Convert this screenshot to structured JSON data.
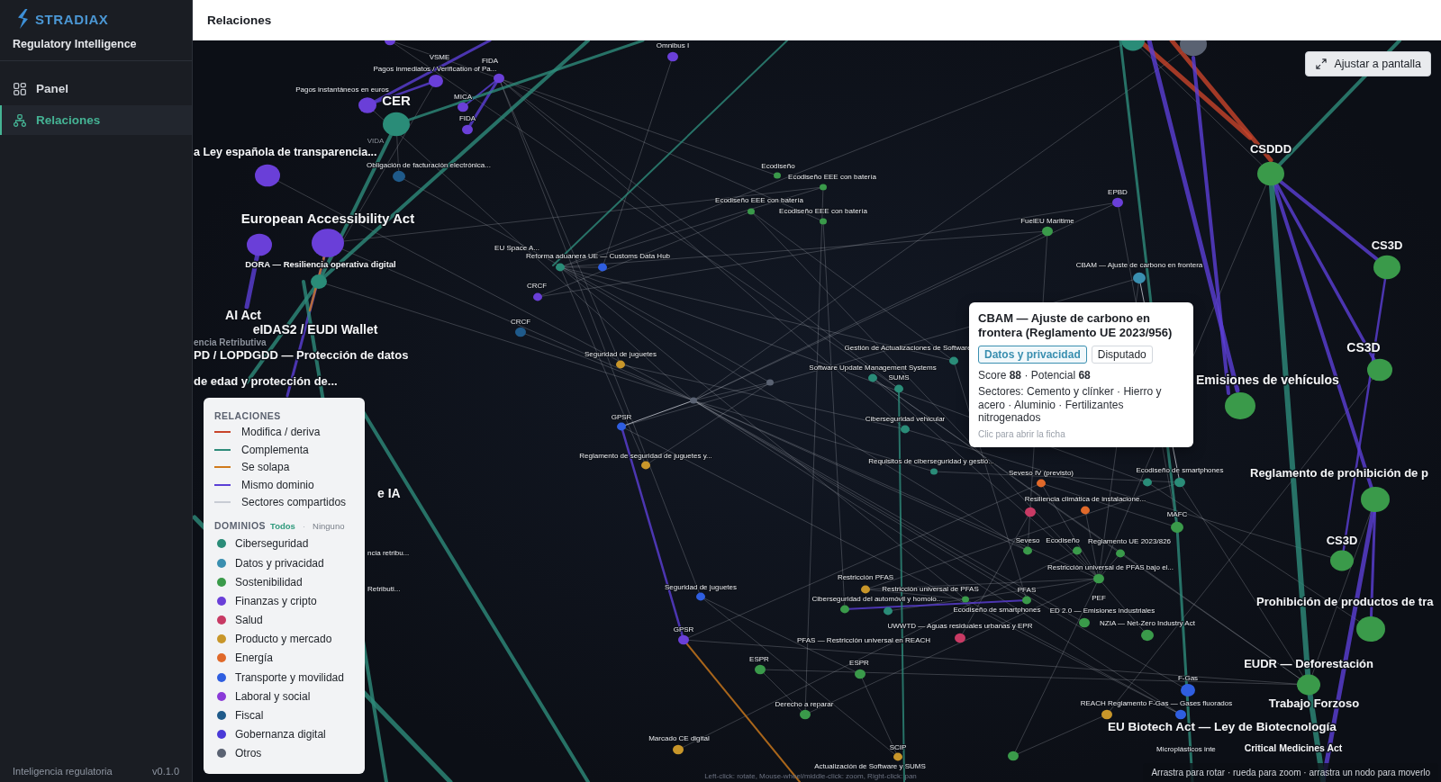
{
  "sidebar": {
    "brand": "STRADIAX",
    "subtitle": "Regulatory Intelligence",
    "nav": [
      {
        "label": "Panel",
        "selected": false
      },
      {
        "label": "Relaciones",
        "selected": true
      }
    ],
    "footer": {
      "label": "Inteligencia regulatoria",
      "version": "v0.1.0"
    }
  },
  "header": {
    "title": "Relaciones"
  },
  "graph": {
    "fit_button": "Ajustar a pantalla",
    "nodes": [
      {
        "color": "#6a3fd8"
      },
      {
        "color": "#2a8c78"
      },
      {
        "color": "#5a6272"
      },
      {
        "label": "Omnibus I",
        "color": "#6a3fd8"
      },
      {
        "label": "VSME",
        "color": "#6a3fd8"
      },
      {
        "label": "FIDA",
        "color": "#6a3fd8"
      },
      {
        "label": "Pagos inmediatos / Verification of Pa..."
      },
      {
        "label": "Pagos instantáneos en euros",
        "color": "#6a3fd8"
      },
      {
        "label": "CER",
        "color": "#2a8c78"
      },
      {
        "label": "MICA",
        "color": "#6a3fd8"
      },
      {
        "label": "FIDA",
        "color": "#6a3fd8"
      },
      {
        "label": "VIDA"
      },
      {
        "label": "a Ley española de transparencia...",
        "color": "#6a3fd8"
      },
      {
        "label": "CSDDD",
        "color": "#3a9a4a"
      },
      {
        "label": "Obligación de facturación electrónica...",
        "color": "#1f5a8a"
      },
      {
        "label": "Ecodiseño",
        "color": "#3a9a4a"
      },
      {
        "label": "Ecodiseño EEE con batería",
        "color": "#3a9a4a"
      },
      {
        "label": "EPBD",
        "color": "#6a3fd8"
      },
      {
        "label": "Ecodiseño EEE con batería",
        "color": "#3a9a4a"
      },
      {
        "label": "European Accessibility Act"
      },
      {
        "label": "Ecodiseño EEE con batería",
        "color": "#3a9a4a"
      },
      {
        "label": "FuelEU Maritime",
        "color": "#3a9a4a"
      },
      {
        "color": "#6a3fd8"
      },
      {
        "color": "#6a3fd8"
      },
      {
        "label": "EU Space A...",
        "color": "#2a8c78"
      },
      {
        "label": "CS3D",
        "color": "#3a9a4a"
      },
      {
        "label": "Reforma aduanera UE — Customs Data Hub",
        "color": "#2f5ee0"
      },
      {
        "label": "DORA — Resiliencia operativa digital",
        "color": "#2a8c78"
      },
      {
        "label": "CBAM — Ajuste de carbono en frontera",
        "color": "#3a8fb0"
      },
      {
        "label": "CRCF",
        "color": "#6a3fd8"
      },
      {
        "label": "AI Act"
      },
      {
        "label": "eIDAS2 / EUDI Wallet"
      },
      {
        "label": "CRCF",
        "color": "#1f5a8a"
      },
      {
        "label": "encia Retributiva"
      },
      {
        "label": "PD / LOPDGDD — Protección de datos"
      },
      {
        "label": "Seguridad de juguetes",
        "color": "#c8962a"
      },
      {
        "label": "Gestión de Actualizaciones de Software",
        "color": "#2a8c78"
      },
      {
        "label": "CS3D",
        "color": "#3a9a4a"
      },
      {
        "label": "Software Update Management Systems",
        "color": "#2a8c78"
      },
      {
        "label": "de edad y protección de..."
      },
      {
        "label": "SUMS",
        "color": "#2a8c78"
      },
      {
        "label": "Emisiones de vehículos",
        "color": "#3a9a4a"
      },
      {
        "color": "#5a6272"
      },
      {
        "color": "#5a6272"
      },
      {
        "label": "GPSR",
        "color": "#2f5ee0"
      },
      {
        "label": "Ciberseguridad vehicular",
        "color": "#2a8c78"
      },
      {
        "label": "Reglamento de seguridad de juguetes y...",
        "color": "#c8962a"
      },
      {
        "label": "Requisitos de ciberseguridad y gestió...",
        "color": "#2a8c78"
      },
      {
        "label": "Seveso IV (previsto)",
        "color": "#e0692a"
      },
      {
        "label": "Ecodiseño de smartphones",
        "color": "#2a8c78"
      },
      {
        "label": "Reglamento de prohibición de p"
      },
      {
        "color": "#2a8c78"
      },
      {
        "label": "e IA"
      },
      {
        "label": "Resiliencia climática de instalacione...",
        "color": "#e0692a"
      },
      {
        "color": "#3a9a4a"
      },
      {
        "color": "#c83a64"
      },
      {
        "label": "MAFC",
        "color": "#3a9a4a"
      },
      {
        "label": "Seveso",
        "color": "#3a9a4a"
      },
      {
        "label": "Ecodiseño",
        "color": "#3a9a4a"
      },
      {
        "label": "Reglamento UE 2023/826",
        "color": "#3a9a4a"
      },
      {
        "label": "CS3D",
        "color": "#3a9a4a"
      },
      {
        "label": "ncia retribu..."
      },
      {
        "label": "Restricción universal de PFAS bajo el...",
        "color": "#3a9a4a"
      },
      {
        "label": "Restricción PFAS",
        "color": "#c8962a"
      },
      {
        "label": "Retributi..."
      },
      {
        "label": "Seguridad de juguetes",
        "color": "#2f5ee0"
      },
      {
        "label": "Restricción universal de PFAS",
        "color": "#3a9a4a"
      },
      {
        "label": "PFAS",
        "color": "#3a9a4a"
      },
      {
        "label": "Ciberseguridad del automóvil y homolo...",
        "color": "#2a8c78"
      },
      {
        "label": "PEF"
      },
      {
        "color": "#3a9a4a"
      },
      {
        "label": "Ecodiseño de smartphones"
      },
      {
        "label": "ED 2.0 — Emisiones industriales",
        "color": "#3a9a4a"
      },
      {
        "label": "Prohibición de productos de tra"
      },
      {
        "label": "GPSR",
        "color": "#6a3fd8"
      },
      {
        "label": "UWWTD — Aguas residuales urbanas y EPR",
        "color": "#c83a64"
      },
      {
        "label": "NZIA — Net-Zero Industry Act",
        "color": "#3a9a4a"
      },
      {
        "color": "#3a9a4a"
      },
      {
        "label": "PFAS — Restricción universal en REACH"
      },
      {
        "label": "ESPR",
        "color": "#3a9a4a"
      },
      {
        "label": "ESPR",
        "color": "#3a9a4a"
      },
      {
        "label": "EUDR — Deforestación",
        "color": "#3a9a4a"
      },
      {
        "label": "F-Gas",
        "color": "#2f5ee0"
      },
      {
        "label": "Derecho a reparar",
        "color": "#3a9a4a"
      },
      {
        "label": "REACH Reglamento F-Gas — Gases fluorados"
      },
      {
        "label": "Trabajo Forzoso"
      },
      {
        "color": "#c8962a"
      },
      {
        "color": "#2f5ee0"
      },
      {
        "label": "EU Biotech Act — Ley de Biotecnología"
      },
      {
        "label": "Marcado CE digital",
        "color": "#c8962a"
      },
      {
        "label": "SCIP",
        "color": "#c8962a"
      },
      {
        "label": "Microplásticos inte"
      },
      {
        "label": "Critical Medicines Act"
      },
      {
        "color": "#3a9a4a"
      },
      {
        "label": "Actualización de Software y SUMS"
      }
    ],
    "controls_hint": "Left-click: rotate, Mouse-wheel/middle-click: zoom, Right-click: pan",
    "hint": "Arrastra para rotar · rueda para zoom · arrastra un nodo para moverlo"
  },
  "legend": {
    "relations_title": "RELACIONES",
    "relations": [
      {
        "label": "Modifica / deriva",
        "color": "#c8442a"
      },
      {
        "label": "Complementa",
        "color": "#2e8b7a"
      },
      {
        "label": "Se solapa",
        "color": "#d07a1c"
      },
      {
        "label": "Mismo dominio",
        "color": "#5b3fd6"
      },
      {
        "label": "Sectores compartidos",
        "color": "#c8ccd4"
      }
    ],
    "domains_title": "DOMINIOS",
    "domain_filters": [
      {
        "label": "Todos",
        "selected": true
      },
      {
        "label": "Ninguno",
        "selected": false
      }
    ],
    "filter_separator": "·",
    "domains": [
      {
        "label": "Ciberseguridad",
        "color": "#2a8c78"
      },
      {
        "label": "Datos y privacidad",
        "color": "#3a8fb0"
      },
      {
        "label": "Sostenibilidad",
        "color": "#3a9a4a"
      },
      {
        "label": "Finanzas y cripto",
        "color": "#6a3fd8"
      },
      {
        "label": "Salud",
        "color": "#c83a64"
      },
      {
        "label": "Producto y mercado",
        "color": "#c8962a"
      },
      {
        "label": "Energía",
        "color": "#e0692a"
      },
      {
        "label": "Transporte y movilidad",
        "color": "#2f5ee0"
      },
      {
        "label": "Laboral y social",
        "color": "#8a3ad8"
      },
      {
        "label": "Fiscal",
        "color": "#1f5a8a"
      },
      {
        "label": "Gobernanza digital",
        "color": "#4a3ad8"
      },
      {
        "label": "Otros",
        "color": "#5a6272"
      }
    ]
  },
  "tooltip": {
    "title": "CBAM — Ajuste de carbono en frontera (Reglamento UE 2023/956)",
    "tags": [
      {
        "label": "Datos y privacidad",
        "kind": "domain",
        "color": "#3a8fb0"
      },
      {
        "label": "Disputado",
        "kind": "status"
      }
    ],
    "score": "Score **88** · Potencial **68**",
    "sectors": "Sectores: Cemento y clínker · Hierro y acero · Aluminio · Fertilizantes nitrogenados",
    "footer": "Clic para abrir la ficha"
  }
}
